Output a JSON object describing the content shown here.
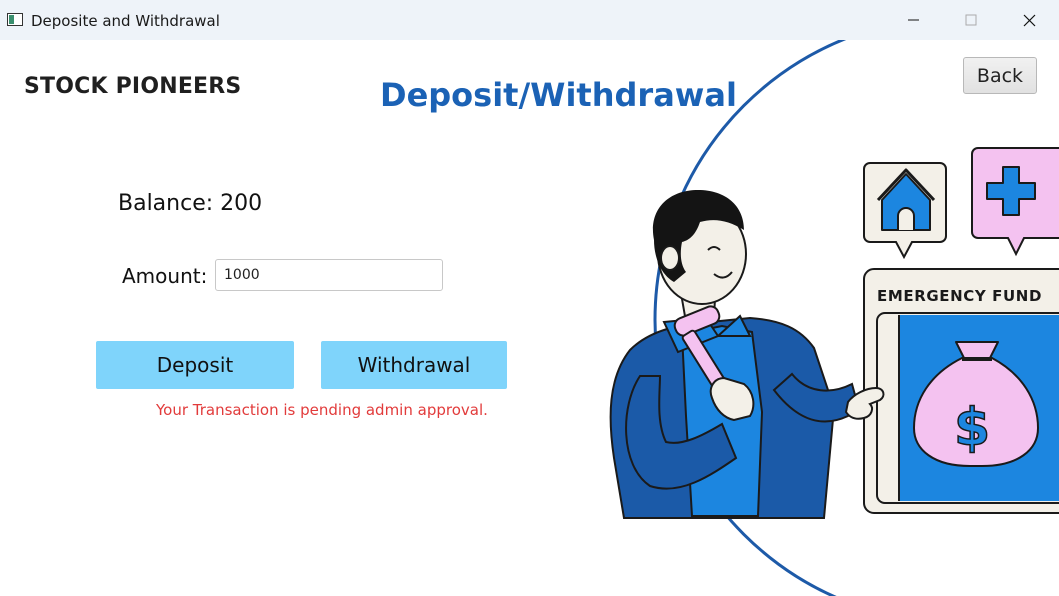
{
  "window": {
    "title": "Deposite and Withdrawal",
    "controls": [
      "minimize",
      "maximize",
      "close"
    ]
  },
  "header": {
    "brand": "STOCK PIONEERS",
    "page_title": "Deposit/Withdrawal",
    "back_label": "Back"
  },
  "form": {
    "balance_text": "Balance: 200",
    "amount_label": "Amount:",
    "amount_value": "1000",
    "deposit_label": "Deposit",
    "withdraw_label": "Withdrawal",
    "status_message": "Your Transaction is pending admin approval."
  },
  "illustration": {
    "sign_text": "EMERGENCY FUND",
    "icons": [
      "house-icon",
      "medical-cross-icon",
      "money-bag-icon",
      "dollar-icon"
    ]
  },
  "colors": {
    "title_blue": "#1b62b5",
    "button_fill": "#7fd4fb",
    "error_red": "#e23b3b",
    "illustration_blue": "#1c86e0",
    "accent_pink": "#f4c2f0"
  }
}
